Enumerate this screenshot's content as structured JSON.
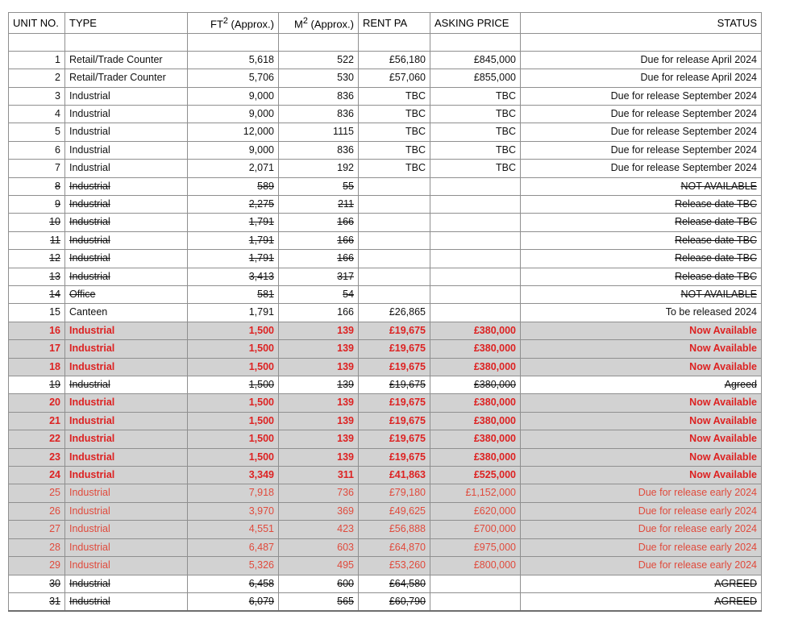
{
  "table": {
    "columns": [
      {
        "key": "unit",
        "label": "UNIT NO.",
        "align": "left"
      },
      {
        "key": "type",
        "label": "TYPE",
        "align": "left"
      },
      {
        "key": "ft2",
        "label": "FT² (Approx.)",
        "align": "right"
      },
      {
        "key": "m2",
        "label": "M² (Approx.)",
        "align": "right"
      },
      {
        "key": "rent",
        "label": "RENT PA",
        "align": "left"
      },
      {
        "key": "ask",
        "label": "ASKING PRICE",
        "align": "left"
      },
      {
        "key": "gap",
        "label": "",
        "align": "left"
      },
      {
        "key": "status",
        "label": "STATUS",
        "align": "right"
      }
    ],
    "colors": {
      "grid_line": "#8f8f8f",
      "outer_border": "#6e6e6e",
      "row_highlight_gray": "#d2d2d2",
      "available_red": "#dd2222",
      "coming_soon_red": "#e04a3c",
      "text_black": "#111111",
      "background": "#ffffff"
    },
    "rows": [
      {
        "style": "spacer",
        "unit": "",
        "type": "",
        "ft2": "",
        "m2": "",
        "rent": "",
        "ask": "",
        "status": ""
      },
      {
        "style": "plain",
        "unit": "1",
        "type": "Retail/Trade Counter",
        "ft2": "5,618",
        "m2": "522",
        "rent": "£56,180",
        "ask": "£845,000",
        "status": "Due for release April 2024"
      },
      {
        "style": "plain",
        "unit": "2",
        "type": "Retail/Trader Counter",
        "ft2": "5,706",
        "m2": "530",
        "rent": "£57,060",
        "ask": "£855,000",
        "status": "Due for release April 2024"
      },
      {
        "style": "plain",
        "unit": "3",
        "type": "Industrial",
        "ft2": "9,000",
        "m2": "836",
        "rent": "TBC",
        "ask": "TBC",
        "status": "Due for release September 2024"
      },
      {
        "style": "plain",
        "unit": "4",
        "type": "Industrial",
        "ft2": "9,000",
        "m2": "836",
        "rent": "TBC",
        "ask": "TBC",
        "status": "Due for release September 2024"
      },
      {
        "style": "plain",
        "unit": "5",
        "type": "Industrial",
        "ft2": "12,000",
        "m2": "1115",
        "rent": "TBC",
        "ask": "TBC",
        "status": "Due for release September 2024"
      },
      {
        "style": "plain",
        "unit": "6",
        "type": "Industrial",
        "ft2": "9,000",
        "m2": "836",
        "rent": "TBC",
        "ask": "TBC",
        "status": "Due for release September 2024"
      },
      {
        "style": "plain",
        "unit": "7",
        "type": "Industrial",
        "ft2": "2,071",
        "m2": "192",
        "rent": "TBC",
        "ask": "TBC",
        "status": "Due for release September 2024"
      },
      {
        "style": "struck",
        "unit": "8",
        "type": "Industrial",
        "ft2": "589",
        "m2": "55",
        "rent": "",
        "ask": "",
        "status": "NOT AVAILABLE"
      },
      {
        "style": "struck",
        "unit": "9",
        "type": "Industrial",
        "ft2": "2,275",
        "m2": "211",
        "rent": "",
        "ask": "",
        "status": "Release date TBC"
      },
      {
        "style": "struck",
        "unit": "10",
        "type": "Industrial",
        "ft2": "1,791",
        "m2": "166",
        "rent": "",
        "ask": "",
        "status": "Release date TBC"
      },
      {
        "style": "struck",
        "unit": "11",
        "type": "Industrial",
        "ft2": "1,791",
        "m2": "166",
        "rent": "",
        "ask": "",
        "status": "Release date TBC"
      },
      {
        "style": "struck",
        "unit": "12",
        "type": "Industrial",
        "ft2": "1,791",
        "m2": "166",
        "rent": "",
        "ask": "",
        "status": "Release date TBC"
      },
      {
        "style": "struck",
        "unit": "13",
        "type": "Industrial",
        "ft2": "3,413",
        "m2": "317",
        "rent": "",
        "ask": "",
        "status": "Release date TBC"
      },
      {
        "style": "struck",
        "unit": "14",
        "type": "Office",
        "ft2": "581",
        "m2": "54",
        "rent": "",
        "ask": "",
        "status": "NOT AVAILABLE"
      },
      {
        "style": "plain",
        "unit": "15",
        "type": "Canteen",
        "ft2": "1,791",
        "m2": "166",
        "rent": "£26,865",
        "ask": "",
        "status": "To be released 2024"
      },
      {
        "style": "hot",
        "unit": "16",
        "type": "Industrial",
        "ft2": "1,500",
        "m2": "139",
        "rent": "£19,675",
        "ask": "£380,000",
        "status": "Now Available"
      },
      {
        "style": "hot",
        "unit": "17",
        "type": "Industrial",
        "ft2": "1,500",
        "m2": "139",
        "rent": "£19,675",
        "ask": "£380,000",
        "status": "Now Available"
      },
      {
        "style": "hot",
        "unit": "18",
        "type": "Industrial",
        "ft2": "1,500",
        "m2": "139",
        "rent": "£19,675",
        "ask": "£380,000",
        "status": "Now Available"
      },
      {
        "style": "struck",
        "unit": "19",
        "type": "Industrial",
        "ft2": "1,500",
        "m2": "139",
        "rent": "£19,675",
        "ask": "£380,000",
        "status": "Agreed"
      },
      {
        "style": "hot",
        "unit": "20",
        "type": "Industrial",
        "ft2": "1,500",
        "m2": "139",
        "rent": "£19,675",
        "ask": "£380,000",
        "status": "Now Available"
      },
      {
        "style": "hot",
        "unit": "21",
        "type": "Industrial",
        "ft2": "1,500",
        "m2": "139",
        "rent": "£19,675",
        "ask": "£380,000",
        "status": "Now Available"
      },
      {
        "style": "hot",
        "unit": "22",
        "type": "Industrial",
        "ft2": "1,500",
        "m2": "139",
        "rent": "£19,675",
        "ask": "£380,000",
        "status": "Now Available"
      },
      {
        "style": "hot",
        "unit": "23",
        "type": "Industrial",
        "ft2": "1,500",
        "m2": "139",
        "rent": "£19,675",
        "ask": "£380,000",
        "status": "Now Available"
      },
      {
        "style": "hot",
        "unit": "24",
        "type": "Industrial",
        "ft2": "3,349",
        "m2": "311",
        "rent": "£41,863",
        "ask": "£525,000",
        "status": "Now Available"
      },
      {
        "style": "soon",
        "unit": "25",
        "type": "Industrial",
        "ft2": "7,918",
        "m2": "736",
        "rent": "£79,180",
        "ask": "£1,152,000",
        "status": "Due for release early 2024"
      },
      {
        "style": "soon",
        "unit": "26",
        "type": "Industrial",
        "ft2": "3,970",
        "m2": "369",
        "rent": "£49,625",
        "ask": "£620,000",
        "status": "Due for release early 2024"
      },
      {
        "style": "soon",
        "unit": "27",
        "type": "Industrial",
        "ft2": "4,551",
        "m2": "423",
        "rent": "£56,888",
        "ask": "£700,000",
        "status": "Due for release early 2024"
      },
      {
        "style": "soon",
        "unit": "28",
        "type": "Industrial",
        "ft2": "6,487",
        "m2": "603",
        "rent": "£64,870",
        "ask": "£975,000",
        "status": "Due for release early 2024"
      },
      {
        "style": "soon",
        "unit": "29",
        "type": "Industrial",
        "ft2": "5,326",
        "m2": "495",
        "rent": "£53,260",
        "ask": "£800,000",
        "status": "Due for release early 2024"
      },
      {
        "style": "struck",
        "unit": "30",
        "type": "Industrial",
        "ft2": "6,458",
        "m2": "600",
        "rent": "£64,580",
        "ask": "",
        "status": "AGREED"
      },
      {
        "style": "struck",
        "unit": "31",
        "type": "Industrial",
        "ft2": "6,079",
        "m2": "565",
        "rent": "£60,790",
        "ask": "",
        "status": "AGREED"
      }
    ]
  }
}
